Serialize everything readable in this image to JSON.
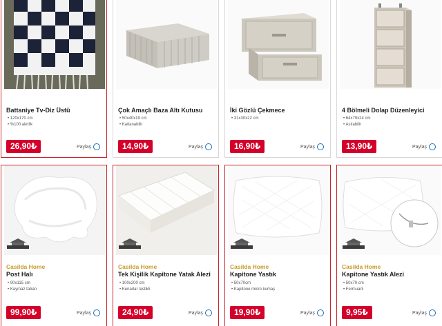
{
  "products": [
    {
      "name": "Battaniye Tv-Diz Üstü",
      "features": [
        "120x170 cm",
        "%100 akrilik"
      ],
      "price": "26,90₺",
      "share": "Paylaş",
      "share_icon": "circle-radio-icon"
    },
    {
      "name": "Çok Amaçlı Baza Altı Kutusu",
      "features": [
        "50x40x19 cm",
        "Katlanabilir"
      ],
      "price": "14,90₺",
      "share": "Paylaş",
      "share_icon": "circle-radio-icon"
    },
    {
      "name": "İki Gözlü Çekmece",
      "features": [
        "31x30x22 cm"
      ],
      "price": "16,90₺",
      "share": "Paylaş",
      "share_icon": "circle-radio-icon"
    },
    {
      "name": "4 Bölmeli Dolap Düzenleyici",
      "features": [
        "64x79x24 cm",
        "Asılabilir"
      ],
      "price": "13,90₺",
      "share": "Paylaş",
      "share_icon": "circle-radio-icon"
    },
    {
      "brand": "Casilda Home",
      "logo": "CASILDA HOME",
      "name": "Post Halı",
      "features": [
        "90x115 cm",
        "Kaymaz taban"
      ],
      "price": "99,90₺",
      "share": "Paylaş",
      "share_icon": "circle-radio-icon"
    },
    {
      "brand": "Casilda Home",
      "logo": "CASILDA HOME",
      "name": "Tek Kişilik Kapitone Yatak Alezi",
      "features": [
        "100x200 cm",
        "Kenarlar lastikli"
      ],
      "price": "24,90₺",
      "share": "Paylaş",
      "share_icon": "circle-radio-icon"
    },
    {
      "brand": "Casilda Home",
      "logo": "CASILDA HOME",
      "name": "Kapitone Yastık",
      "features": [
        "50x70cm",
        "Kapitone micro kumaş"
      ],
      "price": "19,90₺",
      "share": "Paylaş",
      "share_icon": "circle-radio-icon"
    },
    {
      "brand": "Casilda Home",
      "logo": "CASILDA HOME",
      "name": "Kapitone Yastık Alezi",
      "features": [
        "50x70 cm",
        "Fermuarlı"
      ],
      "price": "9,95₺",
      "share": "Paylaş",
      "share_icon": "circle-radio-icon"
    }
  ],
  "colors": {
    "price_bg": "#d4002a",
    "brand": "#c79a2e",
    "selected_border": "#c9242b",
    "share_circle": "#1a6fb5"
  }
}
